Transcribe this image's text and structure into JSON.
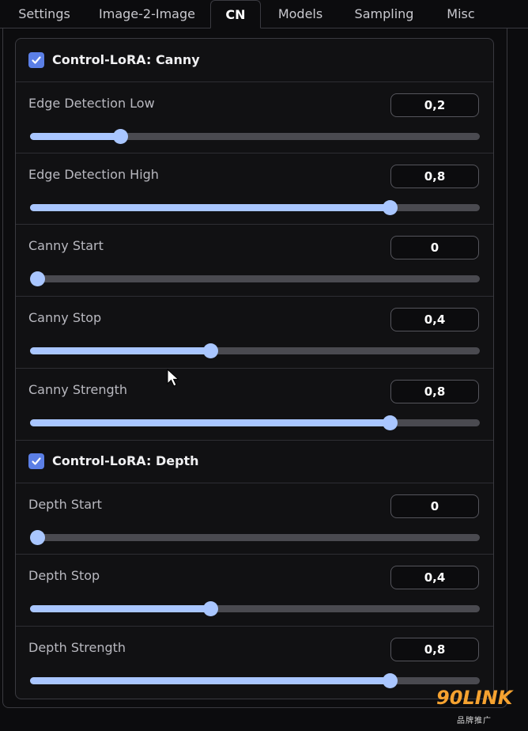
{
  "tabs": [
    {
      "label": "Settings",
      "active": false
    },
    {
      "label": "Image-2-Image",
      "active": false
    },
    {
      "label": "CN",
      "active": true
    },
    {
      "label": "Models",
      "active": false
    },
    {
      "label": "Sampling",
      "active": false
    },
    {
      "label": "Misc",
      "active": false
    }
  ],
  "colors": {
    "accent": "#a9c6ff",
    "checkbox": "#5b7fe6",
    "watermark": "#f5a230"
  },
  "sections": [
    {
      "title": "Control-LoRA: Canny",
      "checked": true,
      "sliders": [
        {
          "label": "Edge Detection Low",
          "value": "0,2",
          "fraction": 0.2
        },
        {
          "label": "Edge Detection High",
          "value": "0,8",
          "fraction": 0.8
        },
        {
          "label": "Canny Start",
          "value": "0",
          "fraction": 0.0
        },
        {
          "label": "Canny Stop",
          "value": "0,4",
          "fraction": 0.4
        },
        {
          "label": "Canny Strength",
          "value": "0,8",
          "fraction": 0.8
        }
      ]
    },
    {
      "title": "Control-LoRA: Depth",
      "checked": true,
      "sliders": [
        {
          "label": "Depth Start",
          "value": "0",
          "fraction": 0.0
        },
        {
          "label": "Depth Stop",
          "value": "0,4",
          "fraction": 0.4
        },
        {
          "label": "Depth Strength",
          "value": "0,8",
          "fraction": 0.8
        }
      ]
    }
  ],
  "watermark": {
    "main": "90LINK",
    "sub": "品牌推广"
  }
}
